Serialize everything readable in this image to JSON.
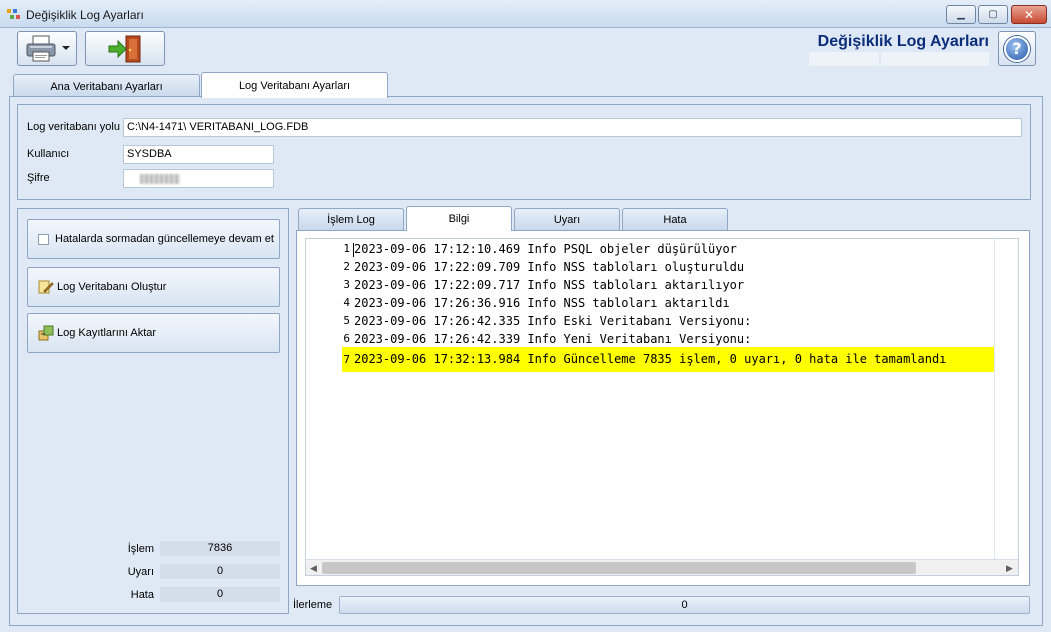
{
  "window": {
    "title": "Değişiklik Log Ayarları",
    "minimize": "▁",
    "maximize": "▢",
    "close": "✕"
  },
  "header": {
    "title": "Değişiklik Log Ayarları",
    "help": "?"
  },
  "tabs": [
    {
      "label": "Ana Veritabanı Ayarları",
      "active": false
    },
    {
      "label": "Log Veritabanı Ayarları",
      "active": true
    }
  ],
  "settings": {
    "path_label": "Log veritabanı yolu",
    "path_value": "C:\\N4-1471\\ VERITABANI_LOG.FDB",
    "user_label": "Kullanıcı",
    "user_value": "SYSDBA",
    "password_label": "Şifre"
  },
  "actions": {
    "continue_checkbox": {
      "label": "Hatalarda sormadan güncellemeye devam et",
      "checked": false
    },
    "create_db": "Log Veritabanı Oluştur",
    "transfer": "Log Kayıtlarını Aktar"
  },
  "stats": {
    "islem_label": "İşlem",
    "islem_value": "7836",
    "uyari_label": "Uyarı",
    "uyari_value": "0",
    "hata_label": "Hata",
    "hata_value": "0"
  },
  "log_tabs": [
    {
      "label": "İşlem Log",
      "active": false
    },
    {
      "label": "Bilgi",
      "active": true
    },
    {
      "label": "Uyarı",
      "active": false
    },
    {
      "label": "Hata",
      "active": false
    }
  ],
  "log_lines": [
    {
      "num": "1",
      "text": "2023-09-06 17:12:10.469 Info PSQL objeler düşürülüyor"
    },
    {
      "num": "2",
      "text": "2023-09-06 17:22:09.709 Info NSS tabloları oluşturuldu"
    },
    {
      "num": "3",
      "text": "2023-09-06 17:22:09.717 Info NSS tabloları aktarılıyor"
    },
    {
      "num": "4",
      "text": "2023-09-06 17:26:36.916 Info NSS tabloları aktarıldı"
    },
    {
      "num": "5",
      "text": "2023-09-06 17:26:42.335 Info Eski Veritabanı Versiyonu:"
    },
    {
      "num": "6",
      "text": "2023-09-06 17:26:42.339 Info Yeni Veritabanı Versiyonu:"
    },
    {
      "num": "7",
      "text": "2023-09-06 17:32:13.984 Info Güncelleme 7835 işlem, 0 uyarı, 0 hata ile tamamlandı"
    }
  ],
  "highlight_color": "#ffff00",
  "progress": {
    "label": "İlerleme",
    "value": "0"
  }
}
